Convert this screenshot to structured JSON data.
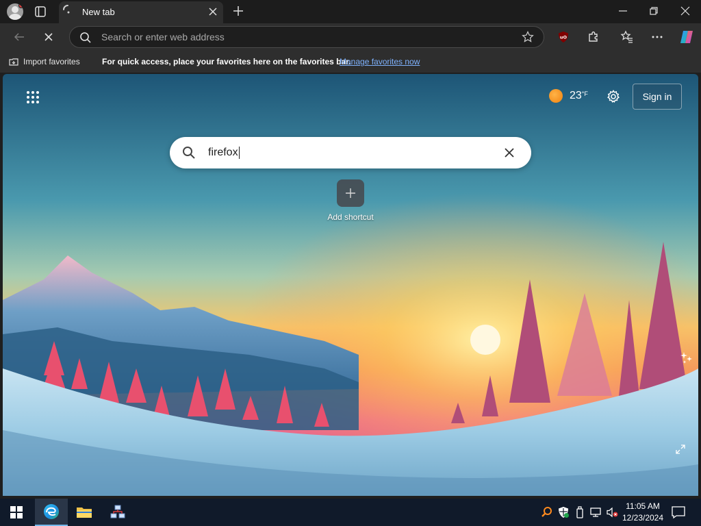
{
  "browser": {
    "tab": {
      "title": "New tab"
    },
    "address_bar": {
      "placeholder": "Search or enter web address"
    }
  },
  "favorites_bar": {
    "import_label": "Import favorites",
    "message": "For quick access, place your favorites here on the favorites bar.",
    "manage_link": "Manage favorites now"
  },
  "new_tab_page": {
    "weather": {
      "temperature": "23",
      "unit": "°F"
    },
    "signin_label": "Sign in",
    "search": {
      "query": "firefox"
    },
    "shortcut": {
      "label": "Add shortcut"
    }
  },
  "taskbar": {
    "time": "11:05 AM",
    "date": "12/23/2024"
  },
  "colors": {
    "link": "#7fb3ff",
    "taskbar_accent": "#76b9ed",
    "weather_sun": "#f0820f"
  }
}
